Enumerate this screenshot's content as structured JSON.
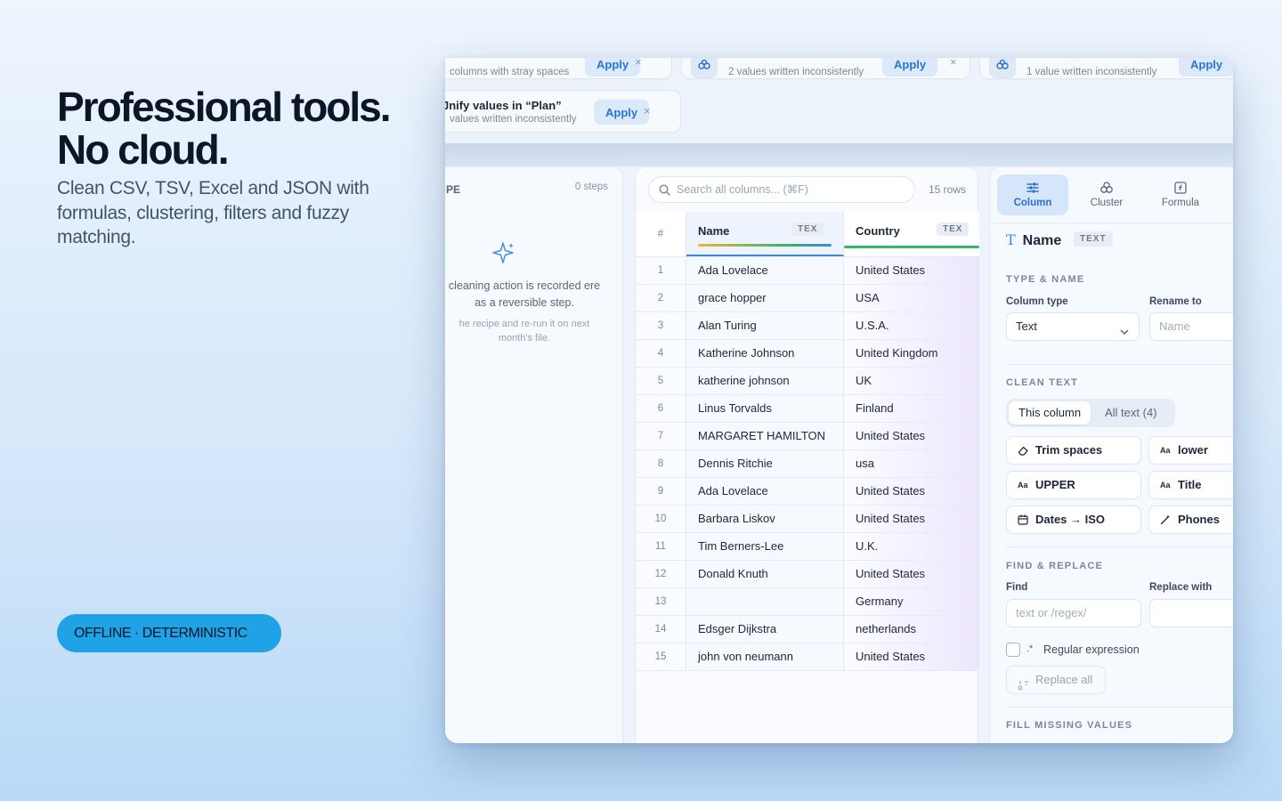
{
  "hero": {
    "title": "Professional tools.\nNo cloud.",
    "subtitle": "Clean CSV, TSV, Excel and JSON with formulas, clustering, filters and fuzzy matching.",
    "badge": "OFFLINE · DETERMINISTIC"
  },
  "suggestions": [
    {
      "desc": "columns with stray spaces",
      "apply": "Apply",
      "close": "×"
    },
    {
      "desc": "2 values written inconsistently",
      "apply": "Apply",
      "close": "×",
      "icon": "cluster-icon"
    },
    {
      "desc": "1 value written inconsistently",
      "apply": "Apply",
      "close": "×",
      "icon": "cluster-icon"
    },
    {
      "title": "Jnify values in “Plan”",
      "desc": "values written inconsistently",
      "apply": "Apply",
      "close": "×"
    }
  ],
  "steps": {
    "header": "PE",
    "count": "0 steps",
    "empty_line1": "cleaning action is recorded ere as a reversible step.",
    "empty_line2": "he recipe and re-run it on next month's file."
  },
  "table": {
    "search_placeholder": "Search all columns... (⌘F)",
    "rows_count": "15 rows",
    "columns": [
      {
        "label": "#"
      },
      {
        "label": "Name",
        "tag": "TEX"
      },
      {
        "label": "Country",
        "tag": "TEX"
      }
    ],
    "rows": [
      {
        "n": "1",
        "name": "Ada Lovelace",
        "country": "United States"
      },
      {
        "n": "2",
        "name": "grace hopper",
        "country": "USA"
      },
      {
        "n": "3",
        "name": "Alan Turing",
        "country": "U.S.A."
      },
      {
        "n": "4",
        "name": "Katherine Johnson",
        "country": "United Kingdom"
      },
      {
        "n": "5",
        "name": "katherine johnson",
        "country": "UK"
      },
      {
        "n": "6",
        "name": "Linus Torvalds",
        "country": "Finland"
      },
      {
        "n": "7",
        "name": "MARGARET HAMILTON",
        "country": "United States"
      },
      {
        "n": "8",
        "name": "Dennis Ritchie",
        "country": "usa"
      },
      {
        "n": "9",
        "name": "Ada Lovelace",
        "country": "United States"
      },
      {
        "n": "10",
        "name": "Barbara Liskov",
        "country": "United States"
      },
      {
        "n": "11",
        "name": "Tim Berners-Lee",
        "country": "U.K."
      },
      {
        "n": "12",
        "name": "Donald Knuth",
        "country": "United States"
      },
      {
        "n": "13",
        "name": "",
        "country": "Germany"
      },
      {
        "n": "14",
        "name": "Edsger Dijkstra",
        "country": "netherlands"
      },
      {
        "n": "15",
        "name": "john von neumann",
        "country": "United States"
      }
    ]
  },
  "inspector": {
    "tabs": [
      {
        "label": "Column",
        "icon": "sliders-icon"
      },
      {
        "label": "Cluster",
        "icon": "cluster-icon"
      },
      {
        "label": "Formula",
        "icon": "formula-icon"
      }
    ],
    "column_name": "Name",
    "column_tag": "TEXT",
    "type_name": {
      "section": "TYPE & NAME",
      "type_label": "Column type",
      "type_value": "Text",
      "rename_label": "Rename to",
      "rename_placeholder": "Name"
    },
    "clean_text": {
      "section": "CLEAN TEXT",
      "scope_this": "This column",
      "scope_all": "All text (4)",
      "buttons": [
        {
          "label": "Trim spaces",
          "icon": "eraser-icon"
        },
        {
          "label": "lower",
          "icon": "case-icon"
        },
        {
          "label": "UPPER",
          "icon": "case-icon"
        },
        {
          "label": "Title",
          "icon": "case-icon"
        },
        {
          "label": "Dates → ISO",
          "icon": "calendar-icon"
        },
        {
          "label": "Phones",
          "icon": "magic-wand-icon"
        }
      ],
      "case_glyph": "Aa"
    },
    "find_replace": {
      "section": "FIND & REPLACE",
      "find_label": "Find",
      "find_placeholder": "text or /regex/",
      "replace_label": "Replace with",
      "replace_placeholder": "",
      "regex_label": "Regular expression",
      "regex_glyph": ".*",
      "replace_all": "Replace all"
    },
    "fill_missing": {
      "section": "FILL MISSING VALUES"
    }
  },
  "colors": {
    "accent": "#3f86e0",
    "badge": "#1fa2e6",
    "name_bar": [
      "#f0b33a",
      "#39b36a",
      "#3f86e0"
    ],
    "country_bar": "#2dbb6a"
  }
}
